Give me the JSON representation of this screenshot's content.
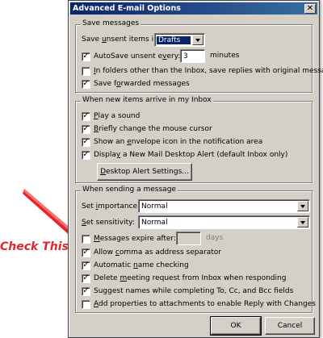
{
  "annotation": {
    "text": "Check This",
    "color": "#e3262e"
  },
  "window": {
    "title": "Advanced E-mail Options",
    "close_glyph": "✕"
  },
  "save_messages": {
    "legend": "Save messages",
    "save_unsent_label_pre": "Save ",
    "save_unsent_label_u": "u",
    "save_unsent_label_post": "nsent items in:",
    "save_unsent_value": "Drafts",
    "autosave": {
      "checked": true,
      "pre": "AutoSave unsent e",
      "u": "v",
      "post": "ery:",
      "value": "3",
      "unit": "minutes"
    },
    "in_folders": {
      "checked": false,
      "pre": "",
      "u": "I",
      "post": "n folders other than the Inbox, save replies with original message"
    },
    "save_forwarded": {
      "checked": true,
      "pre": "Save f",
      "u": "o",
      "post": "rwarded messages"
    }
  },
  "new_items": {
    "legend": "When new items arrive in my Inbox",
    "play_sound": {
      "checked": true,
      "pre": "",
      "u": "P",
      "post": "lay a sound"
    },
    "change_cursor": {
      "checked": true,
      "pre": "",
      "u": "B",
      "post": "riefly change the mouse cursor"
    },
    "envelope_icon": {
      "checked": true,
      "pre": "Show an ",
      "u": "e",
      "post": "nvelope icon in the notification area"
    },
    "desktop_alert": {
      "checked": true,
      "pre": "Displa",
      "u": "y",
      "post": " a New Mail Desktop Alert (default Inbox only)"
    },
    "desktop_alert_settings_button": {
      "pre": "",
      "u": "D",
      "post": "esktop Alert Settings..."
    }
  },
  "sending": {
    "legend": "When sending a message",
    "importance": {
      "pre": "Set ",
      "u": "i",
      "post": "mportance:",
      "value": "Normal"
    },
    "sensitivity": {
      "pre": "",
      "u": "S",
      "post": "et sensitivity:",
      "value": "Normal"
    },
    "expire": {
      "checked": false,
      "pre": "",
      "u": "M",
      "post": "essages expire after:",
      "value": "",
      "unit": "days"
    },
    "comma_separator": {
      "checked": true,
      "pre": "Allow ",
      "u": "c",
      "post": "omma as address separator"
    },
    "name_checking": {
      "checked": true,
      "pre": "Automatic ",
      "u": "n",
      "post": "ame checking"
    },
    "delete_meeting": {
      "checked": true,
      "pre": "Delete ",
      "u": "m",
      "post": "eeting request from Inbox when responding"
    },
    "suggest_names": {
      "checked": true,
      "pre": "Suggest names while completing To, Cc, and Bcc fields",
      "u": "",
      "post": ""
    },
    "add_properties": {
      "checked": false,
      "pre": "",
      "u": "A",
      "post": "dd properties to attachments to enable Reply with Changes"
    }
  },
  "buttons": {
    "ok": "OK",
    "cancel": "Cancel"
  },
  "colors": {
    "dialog_bg": "#d4d0c8",
    "titlebar": "#0a246a",
    "selection": "#0a246a"
  }
}
